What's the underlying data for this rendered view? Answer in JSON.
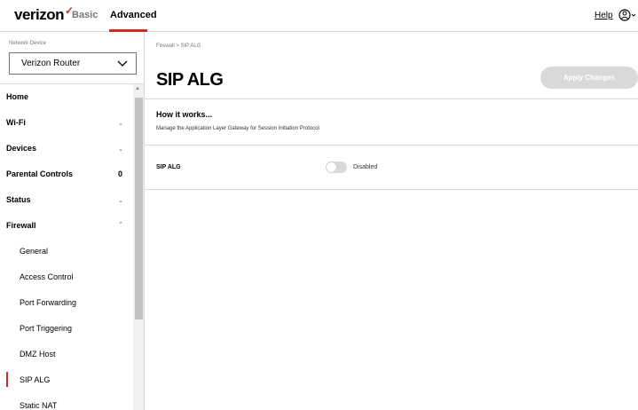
{
  "header": {
    "logo_text": "verizon",
    "logo_mark": "✓",
    "tabs": [
      {
        "label": "Basic",
        "active": false
      },
      {
        "label": "Advanced",
        "active": true
      }
    ],
    "help_label": "Help",
    "accent_color": "#d52b1e"
  },
  "sidebar": {
    "device_label": "Network Device",
    "device_value": "Verizon Router",
    "items": [
      {
        "label": "Home",
        "icon": ""
      },
      {
        "label": "Wi-Fi",
        "icon": "chevron-down"
      },
      {
        "label": "Devices",
        "icon": "chevron-down"
      },
      {
        "label": "Parental Controls",
        "badge": "0"
      },
      {
        "label": "Status",
        "icon": "chevron-down"
      },
      {
        "label": "Firewall",
        "icon": "chevron-up"
      }
    ],
    "firewall_subitems": [
      {
        "label": "General"
      },
      {
        "label": "Access Control"
      },
      {
        "label": "Port Forwarding"
      },
      {
        "label": "Port Triggering"
      },
      {
        "label": "DMZ Host"
      },
      {
        "label": "SIP ALG",
        "active": true
      },
      {
        "label": "Static NAT"
      }
    ]
  },
  "main": {
    "breadcrumb": "Firewall  >  SIP ALG",
    "title": "SIP ALG",
    "apply_label": "Apply Changes",
    "how_title": "How it works...",
    "how_desc": "Manage the Application Layer Gateway for Session Initiation Protocol",
    "setting_label": "SIP ALG",
    "toggle_enabled": false,
    "toggle_status": "Disabled"
  }
}
